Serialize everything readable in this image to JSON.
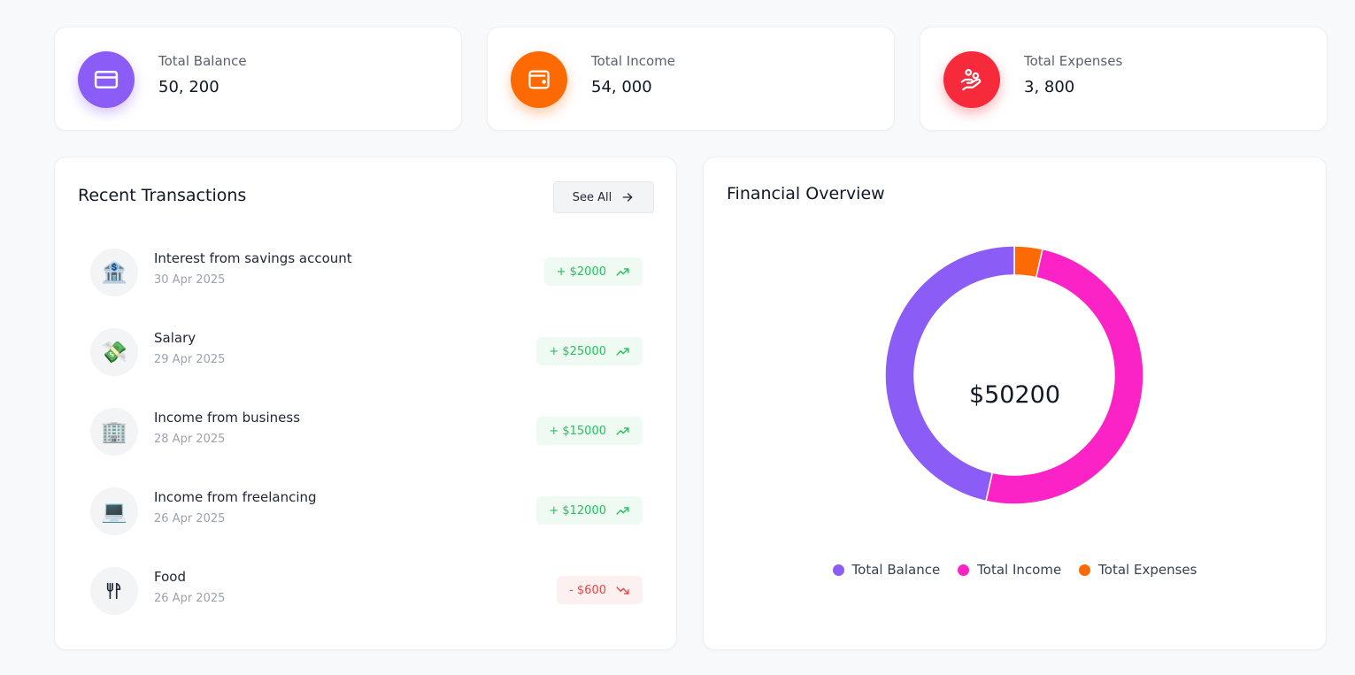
{
  "stats": [
    {
      "label": "Total Balance",
      "value": "50, 200",
      "icon": "credit-card-icon",
      "color": "#8b5cf6"
    },
    {
      "label": "Total Income",
      "value": "54, 000",
      "icon": "wallet-icon",
      "color": "#fd6a04"
    },
    {
      "label": "Total Expenses",
      "value": "3, 800",
      "icon": "hand-money-icon",
      "color": "#f62a3a"
    }
  ],
  "transactions": {
    "title": "Recent Transactions",
    "see_all_label": "See All",
    "items": [
      {
        "name": "Interest from savings account",
        "date": "30 Apr 2025",
        "amount": "+ $2000",
        "type": "income",
        "icon": "bank-emoji",
        "emoji": "🏦"
      },
      {
        "name": "Salary",
        "date": "29 Apr 2025",
        "amount": "+ $25000",
        "type": "income",
        "icon": "money-with-wings-emoji",
        "emoji": "💸"
      },
      {
        "name": "Income from business",
        "date": "28 Apr 2025",
        "amount": "+ $15000",
        "type": "income",
        "icon": "office-building-emoji",
        "emoji": "🏢"
      },
      {
        "name": "Income from freelancing",
        "date": "26 Apr 2025",
        "amount": "+ $12000",
        "type": "income",
        "icon": "laptop-emoji",
        "emoji": "💻"
      },
      {
        "name": "Food",
        "date": "26 Apr 2025",
        "amount": "- $600",
        "type": "expense",
        "icon": "utensils-icon",
        "emoji": ""
      }
    ]
  },
  "overview": {
    "title": "Financial Overview",
    "center_label": "$50200"
  },
  "chart_data": {
    "type": "pie",
    "categories": [
      "Total Balance",
      "Total Income",
      "Total Expenses"
    ],
    "values": [
      50200,
      54000,
      3800
    ],
    "colors": [
      "#8b5cf6",
      "#fb23c5",
      "#fb6a04"
    ],
    "legend_position": "bottom"
  }
}
